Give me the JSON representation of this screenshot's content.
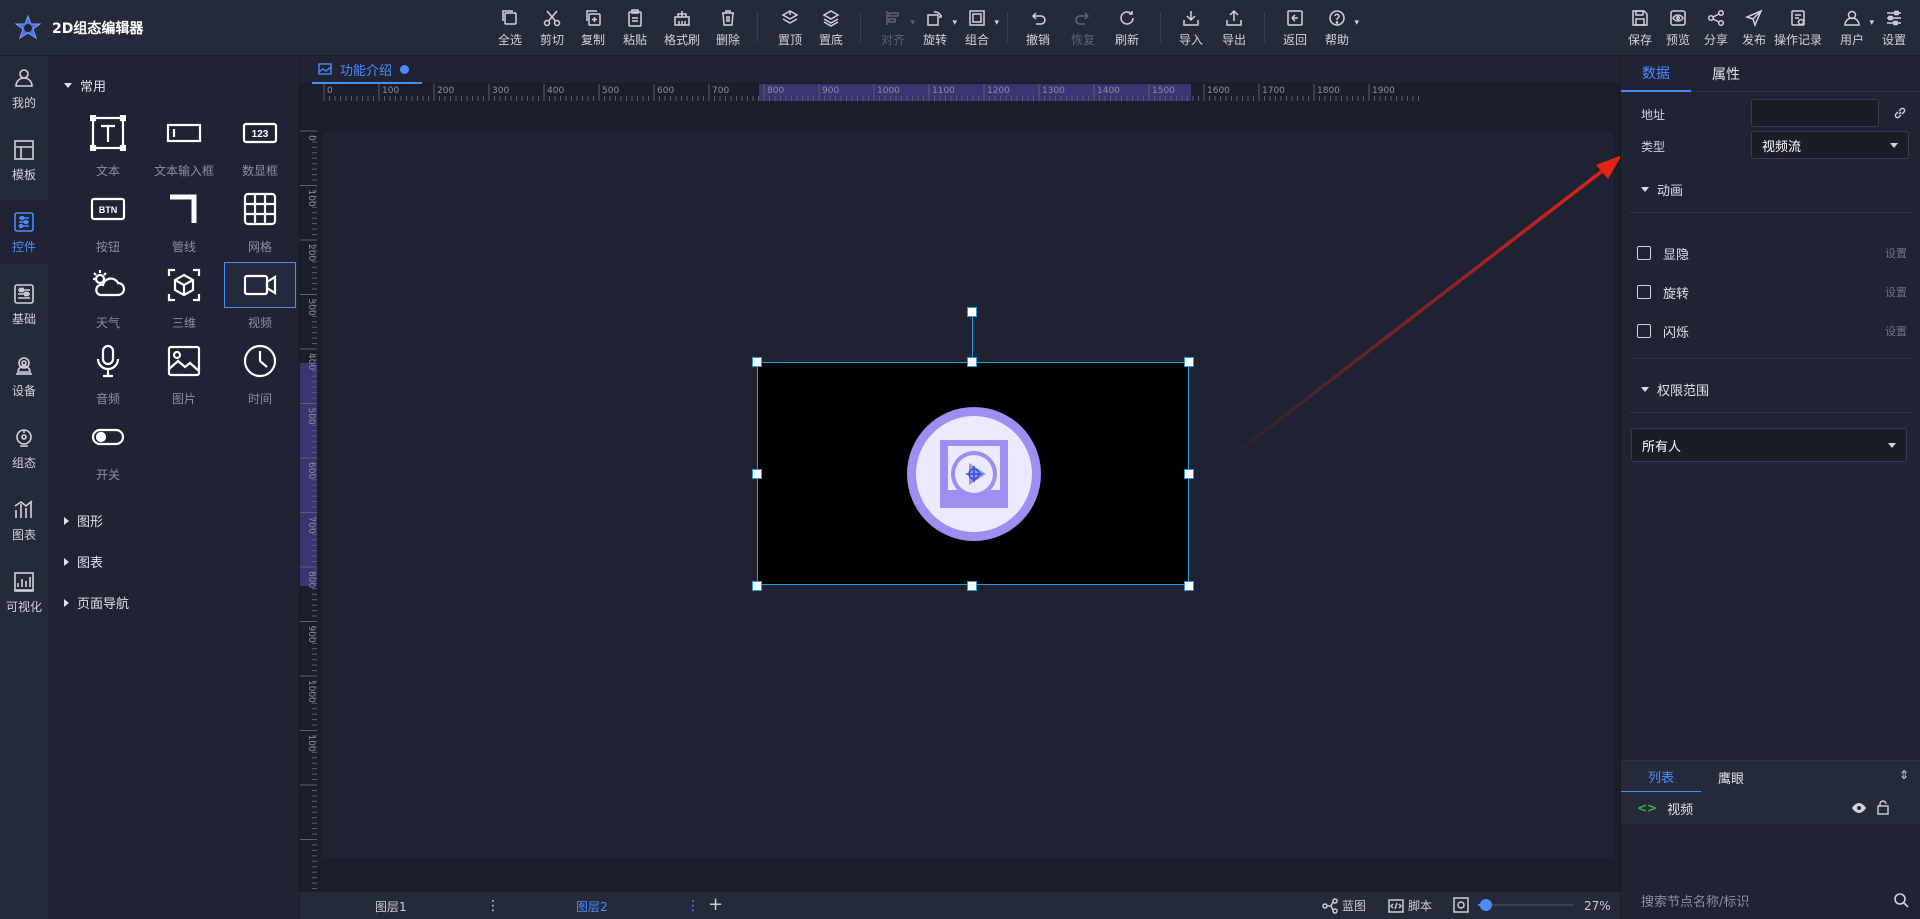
{
  "app": {
    "title": "2D组态编辑器"
  },
  "toolbar": {
    "select_all": "全选",
    "cut": "剪切",
    "copy": "复制",
    "paste": "粘贴",
    "format_painter": "格式刷",
    "delete": "删除",
    "bring_to_top": "置顶",
    "send_to_bottom": "置底",
    "align": "对齐",
    "rotate": "旋转",
    "group": "组合",
    "undo": "撤销",
    "redo": "恢复",
    "refresh": "刷新",
    "import": "导入",
    "export": "导出",
    "back": "返回",
    "help": "帮助",
    "save": "保存",
    "preview": "预览",
    "share": "分享",
    "publish": "发布",
    "history": "操作记录",
    "user": "用户",
    "settings": "设置"
  },
  "rail": [
    {
      "label": "我的",
      "icon": "user-icon"
    },
    {
      "label": "模板",
      "icon": "template-icon"
    },
    {
      "label": "控件",
      "icon": "sliders-icon",
      "active": true
    },
    {
      "label": "基础",
      "icon": "basic-icon"
    },
    {
      "label": "设备",
      "icon": "device-icon"
    },
    {
      "label": "组态",
      "icon": "config-icon"
    },
    {
      "label": "图表",
      "icon": "chart-icon"
    },
    {
      "label": "可视化",
      "icon": "visual-icon"
    }
  ],
  "components": {
    "section_common": "常用",
    "items": [
      {
        "label": "文本"
      },
      {
        "label": "文本输入框"
      },
      {
        "label": "数显框"
      },
      {
        "label": "按钮"
      },
      {
        "label": "管线"
      },
      {
        "label": "网格"
      },
      {
        "label": "天气"
      },
      {
        "label": "三维"
      },
      {
        "label": "视频",
        "selected": true
      },
      {
        "label": "音频"
      },
      {
        "label": "图片"
      },
      {
        "label": "时间"
      },
      {
        "label": "开关"
      }
    ],
    "section_shapes": "图形",
    "section_charts": "图表",
    "section_nav": "页面导航",
    "icon_texts": {
      "numeric": "123",
      "button": "BTN"
    }
  },
  "document": {
    "tab_label": "功能介绍"
  },
  "ruler": {
    "h_ticks": [
      "0",
      "100",
      "200",
      "300",
      "400",
      "500",
      "600",
      "700",
      "800",
      "900",
      "1000",
      "1100",
      "1200",
      "1300",
      "1400",
      "1500",
      "1600",
      "1700",
      "1800",
      "1900"
    ],
    "v_ticks": [
      "0",
      "100",
      "200",
      "300",
      "400",
      "500",
      "600",
      "700",
      "800",
      "900",
      "1000",
      "100"
    ]
  },
  "layers": {
    "layer1": "图层1",
    "layer2": "图层2"
  },
  "footer": {
    "blueprint": "蓝图",
    "script": "脚本",
    "zoom": "27%",
    "zoom_fraction": 0.27
  },
  "props": {
    "tab_data": "数据",
    "tab_attr": "属性",
    "address_label": "地址",
    "address_value": "",
    "type_label": "类型",
    "type_value": "视频流",
    "animation_section": "动画",
    "anim_items": [
      {
        "label": "显隐",
        "set": "设置"
      },
      {
        "label": "旋转",
        "set": "设置"
      },
      {
        "label": "闪烁",
        "set": "设置"
      }
    ],
    "permission_section": "权限范围",
    "permission_value": "所有人"
  },
  "layer_panel": {
    "tab_list": "列表",
    "tab_eagle": "鹰眼",
    "node_label": "视频",
    "search_placeholder": "搜索节点名称/标识"
  },
  "colors": {
    "accent": "#4a8cff",
    "selection": "#2d9bd8",
    "video_circle": "#9d8ef0",
    "annotation_arrow": "#e02418"
  }
}
